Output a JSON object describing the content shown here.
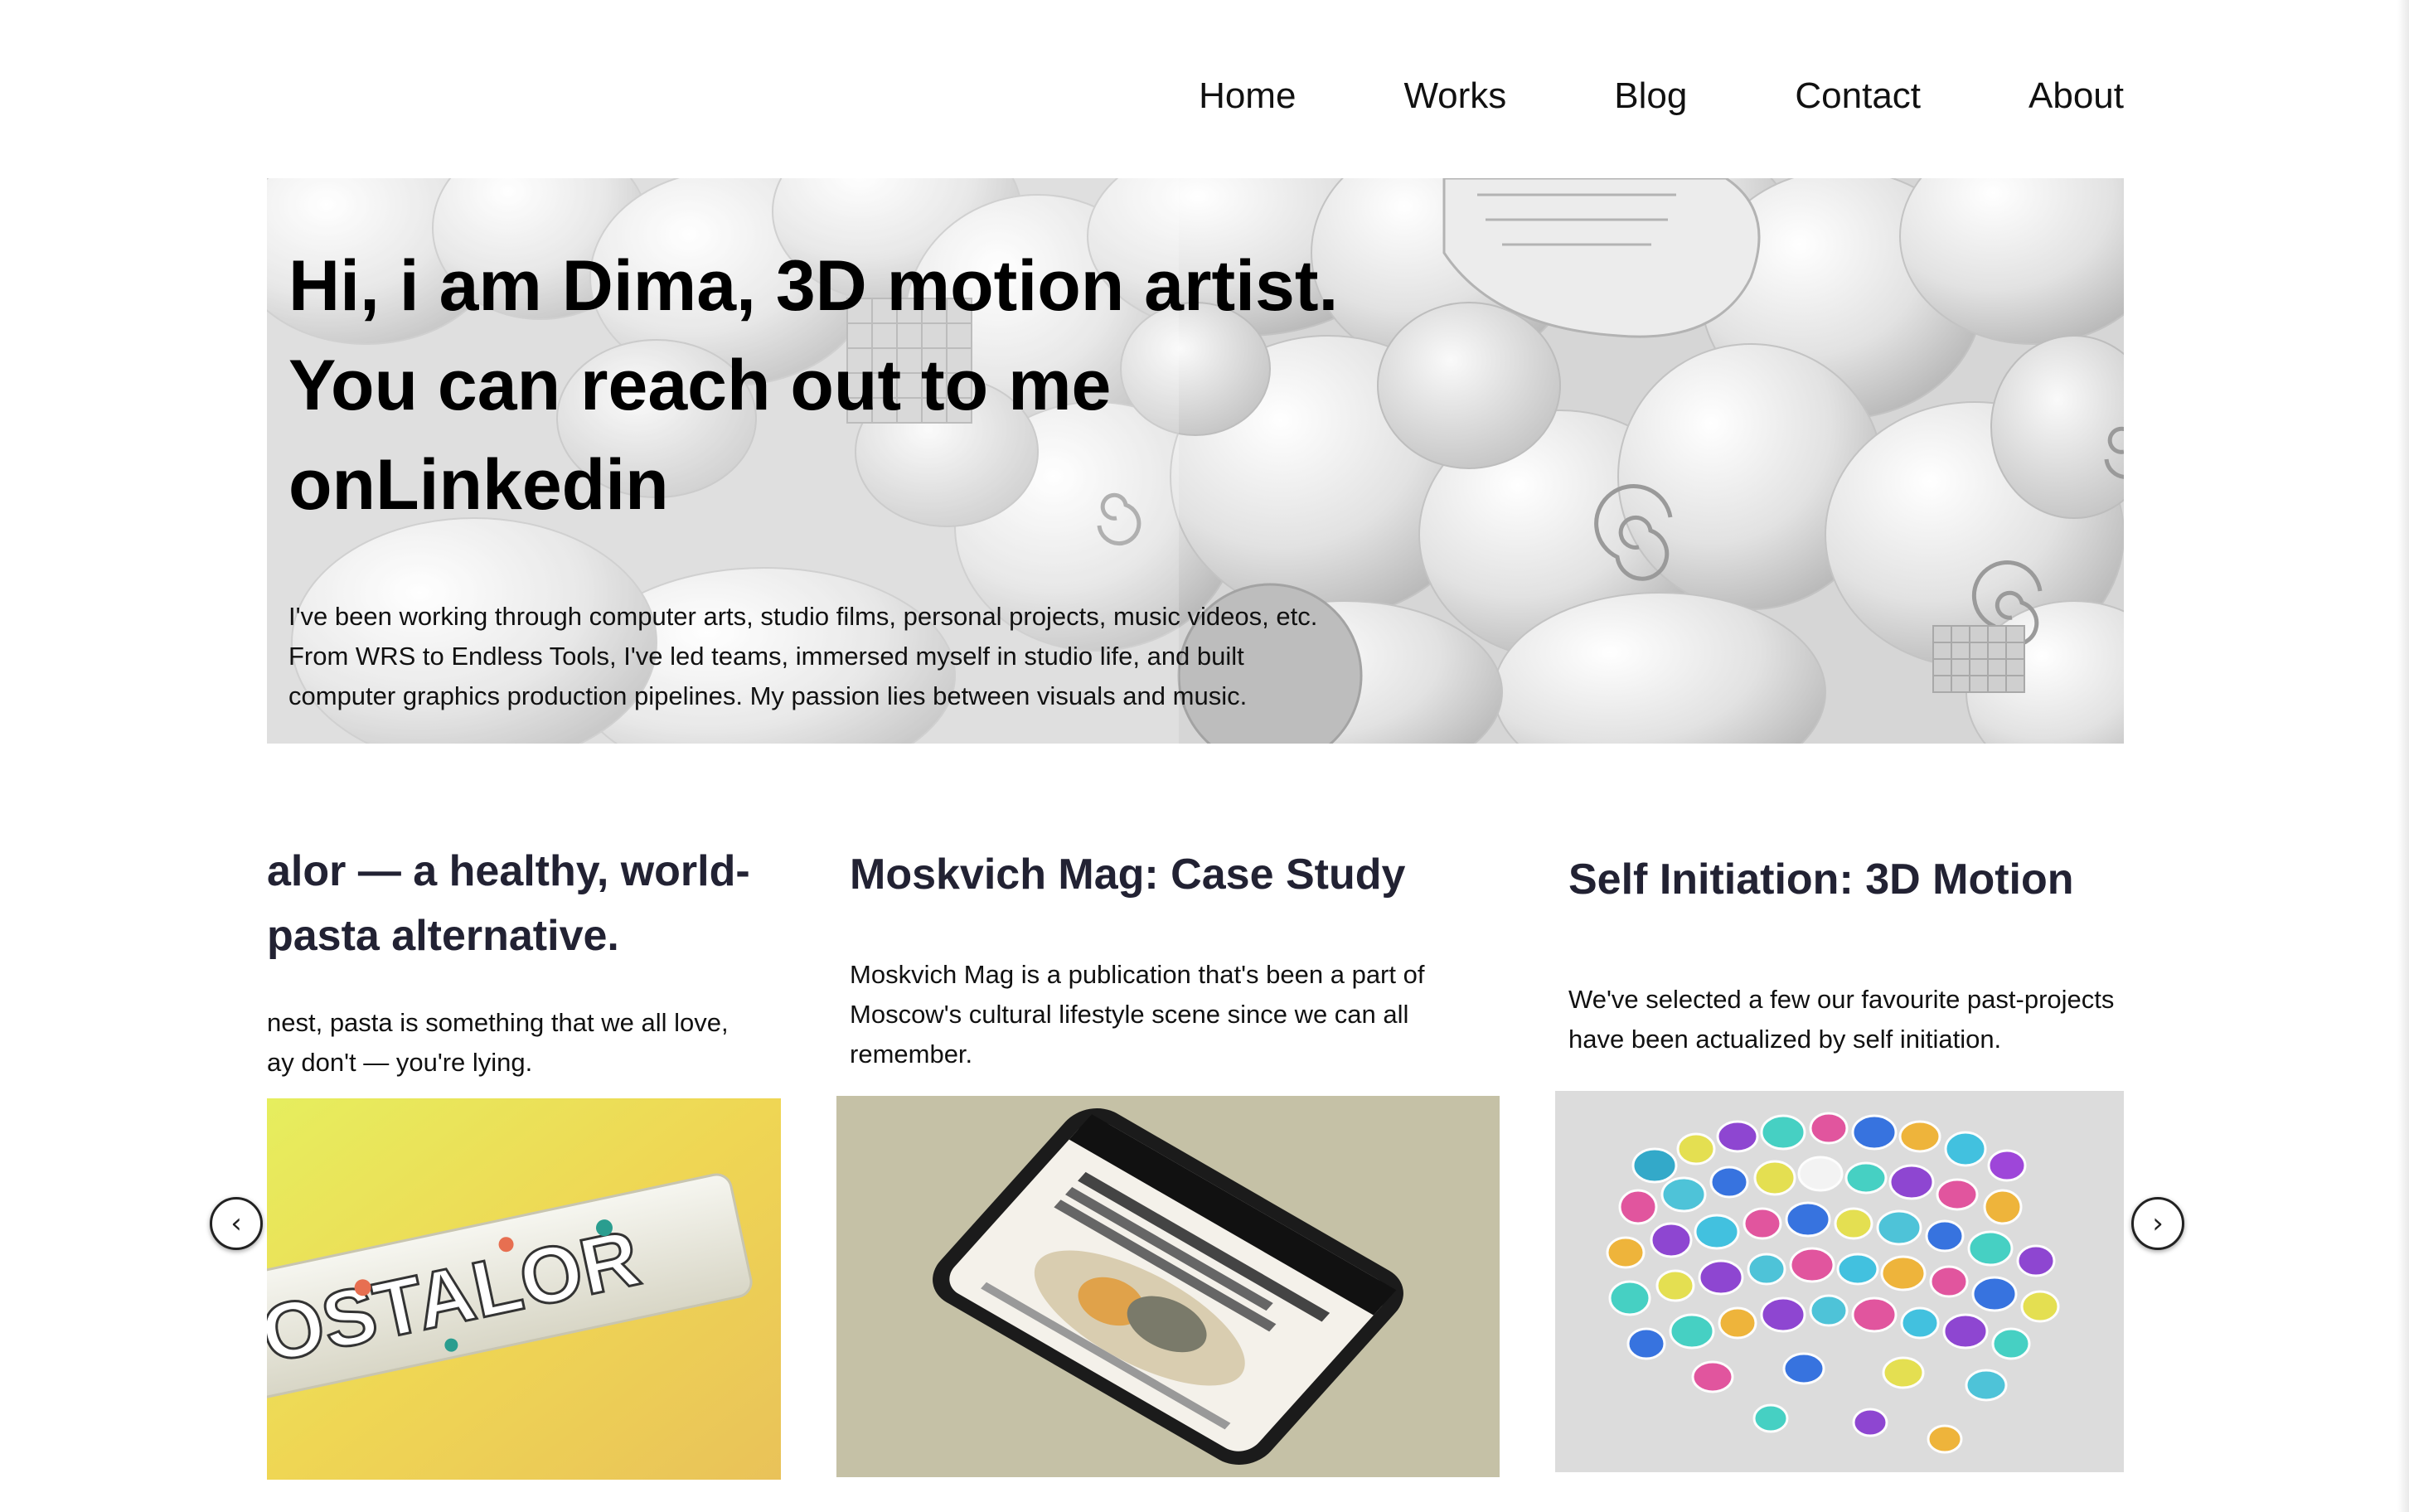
{
  "nav": {
    "items": [
      {
        "label": "Home"
      },
      {
        "label": "Works"
      },
      {
        "label": "Blog"
      },
      {
        "label": "Contact"
      },
      {
        "label": "About"
      }
    ]
  },
  "hero": {
    "title_lines": [
      "Hi, i am Dima, 3D motion artist.",
      "You can reach out to me",
      "onLinkedin"
    ],
    "desc_lines": [
      "I've been working through computer arts, studio films, personal projects, music videos, etc.",
      "From WRS to Endless Tools, I've led teams, immersed myself in studio life, and built",
      "computer graphics production pipelines. My passion lies between visuals and music."
    ]
  },
  "carousel": {
    "cards": [
      {
        "title_lines": [
          "alor — a healthy, world-",
          " pasta alternative."
        ],
        "desc_lines": [
          "nest, pasta is something that we all love,",
          "ay don't — you're lying."
        ],
        "image": "pasta-package-image",
        "image_text": "OSTALOR"
      },
      {
        "title_lines": [
          "Moskvich Mag: Case Study"
        ],
        "desc_lines": [
          "Moskvich Mag is a publication that's been a part of",
          "Moscow's cultural lifestyle scene since we can all",
          "remember."
        ],
        "image": "smartphone-mockup-image"
      },
      {
        "title_lines": [
          "Self Initiation: 3D Motion"
        ],
        "desc_lines": [
          "We've selected a few our favourite past-projects",
          "have been actualized by self initiation."
        ],
        "image": "colorful-glass-pebbles-image"
      }
    ],
    "prev_icon": "chevron-left-icon",
    "next_icon": "chevron-right-icon"
  },
  "colors": {
    "heading": "#222233",
    "hero_bg": "#dcdcdc",
    "card2_bg": "#c5c1a6",
    "card1_bg": "#e7d850"
  }
}
